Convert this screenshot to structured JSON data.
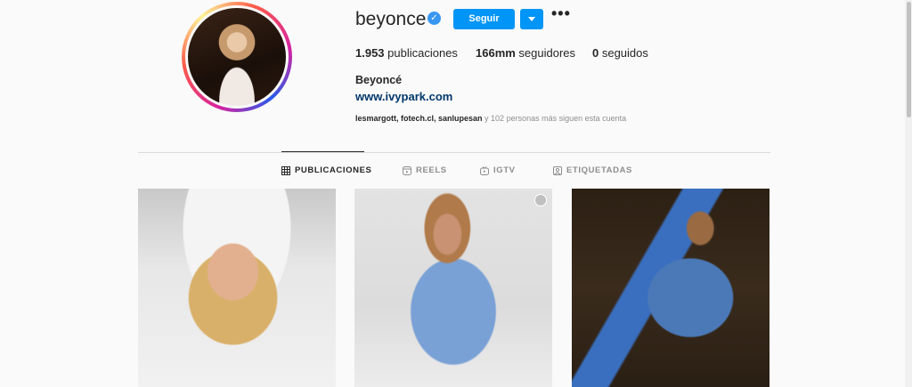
{
  "profile": {
    "username": "beyonce",
    "verified_symbol": "✓",
    "follow_label": "Seguir",
    "more_symbol": "•••",
    "full_name": "Beyoncé",
    "website": "www.ivypark.com",
    "followed_by_names": "lesmargott, fotech.cl, sanlupesan",
    "followed_by_rest": " y 102 personas más siguen esta cuenta"
  },
  "stats": {
    "posts_count": "1.953",
    "posts_label": " publicaciones",
    "followers_count": "166mm",
    "followers_label": " seguidores",
    "following_count": "0",
    "following_label": " seguidos"
  },
  "tabs": [
    {
      "label": "PUBLICACIONES",
      "icon": "grid-icon",
      "active": true
    },
    {
      "label": "REELS",
      "icon": "reels-icon",
      "active": false
    },
    {
      "label": "IGTV",
      "icon": "igtv-icon",
      "active": false
    },
    {
      "label": "ETIQUETADAS",
      "icon": "tagged-icon",
      "active": false
    }
  ],
  "posts": [
    {
      "type": "photo"
    },
    {
      "type": "reel"
    },
    {
      "type": "photo"
    }
  ],
  "colors": {
    "accent": "#0095f6",
    "verified": "#3897f0",
    "link": "#00376b",
    "muted": "#8e8e8e"
  }
}
